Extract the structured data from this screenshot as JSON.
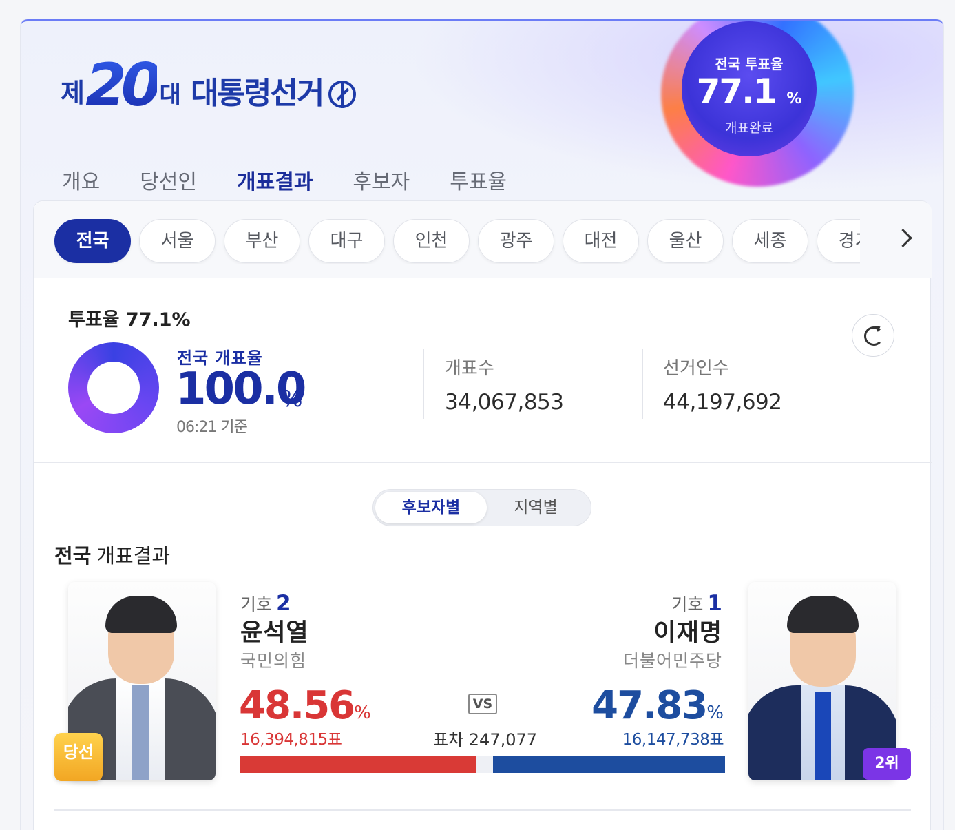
{
  "header": {
    "title_prefix": "제",
    "title_number": "20",
    "title_suffix": "대",
    "title_main": "대통령선거"
  },
  "turnout_orb": {
    "label": "전국 투표율",
    "value": "77.1",
    "unit": "%",
    "status": "개표완료"
  },
  "tabs": [
    {
      "label": "개요",
      "active": false
    },
    {
      "label": "당선인",
      "active": false
    },
    {
      "label": "개표결과",
      "active": true
    },
    {
      "label": "후보자",
      "active": false
    },
    {
      "label": "투표율",
      "active": false
    }
  ],
  "regions": [
    "전국",
    "서울",
    "부산",
    "대구",
    "인천",
    "광주",
    "대전",
    "울산",
    "세종",
    "경기"
  ],
  "active_region": "전국",
  "stats": {
    "turnout_title": "투표율 77.1%",
    "count_rate_label": "전국 개표율",
    "count_rate_value": "100.0",
    "count_rate_unit": "%",
    "count_rate_fraction": 1.0,
    "as_of": "06:21 기준",
    "counted_label": "개표수",
    "counted_value": "34,067,853",
    "electorate_label": "선거인수",
    "electorate_value": "44,197,692"
  },
  "view_toggle": {
    "on": "후보자별",
    "off": "지역별"
  },
  "results": {
    "region_bold": "전국",
    "title": "개표결과",
    "vs": "VS",
    "gap_label": "표차 247,077",
    "left": {
      "number_label": "기호",
      "number": "2",
      "name": "윤석열",
      "party": "국민의힘",
      "pct": "48.56",
      "pct_unit": "%",
      "votes": "16,394,815표",
      "badge": "당선",
      "color": "#d93a36"
    },
    "right": {
      "number_label": "기호",
      "number": "1",
      "name": "이재명",
      "party": "더불어민주당",
      "pct": "47.83",
      "pct_unit": "%",
      "votes": "16,147,738표",
      "badge": "2위",
      "color": "#1d4d9f"
    }
  }
}
